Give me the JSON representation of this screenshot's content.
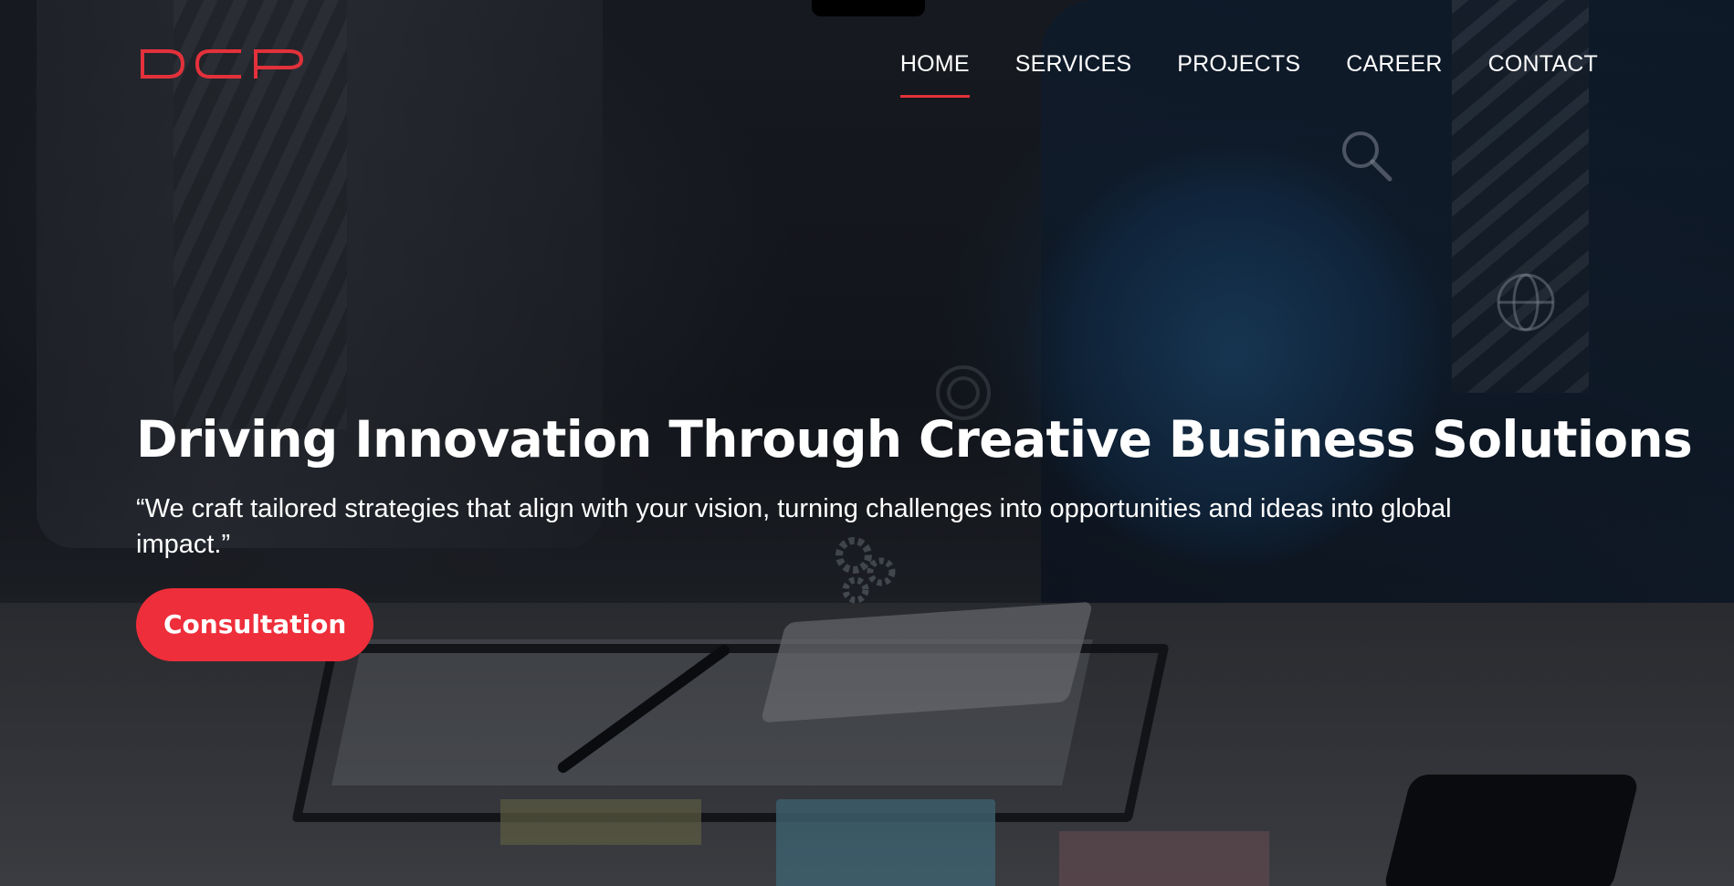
{
  "brand": {
    "logo_text": "DCP",
    "accent_color": "#e3313b"
  },
  "nav": {
    "items": [
      {
        "label": "HOME",
        "active": true
      },
      {
        "label": "SERVICES",
        "active": false
      },
      {
        "label": "PROJECTS",
        "active": false
      },
      {
        "label": "CAREER",
        "active": false
      },
      {
        "label": "CONTACT",
        "active": false
      }
    ]
  },
  "hero": {
    "title": "Driving Innovation Through Creative Business Solutions",
    "subtitle": "“We craft tailored strategies that align with your vision, turning challenges into opportunities and ideas into global impact.”",
    "cta_label": "Consultation",
    "cta_color": "#ee2e3a"
  },
  "background": {
    "icons": [
      "magnifier-icon",
      "web-globe-icon",
      "gear-icon",
      "target-icon"
    ]
  }
}
